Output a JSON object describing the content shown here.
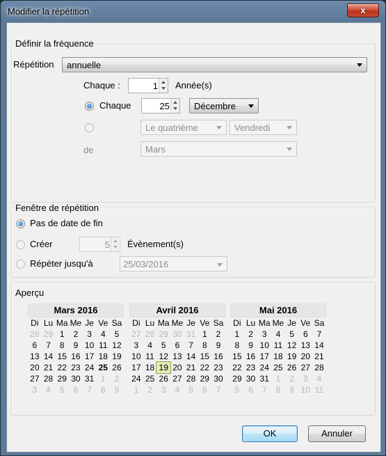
{
  "window": {
    "title": "Modifier la répétition",
    "close_label": "x"
  },
  "frequency": {
    "group_label": "Définir la fréquence",
    "repetition_label": "Répétition",
    "repetition_value": "annuelle",
    "each_label": "Chaque :",
    "each_value": "1",
    "each_unit": "Année(s)",
    "option_each_label": "Chaque",
    "option_each_day": "25",
    "option_each_month": "Décembre",
    "ordinal_value": "Le quatrième",
    "weekday_value": "Vendredi",
    "of_label": "de",
    "of_month_value": "Mars"
  },
  "window_repeat": {
    "group_label": "Fenêtre de répétition",
    "no_end_label": "Pas de date de fin",
    "create_label": "Créer",
    "create_count": "5",
    "create_unit": "Évènement(s)",
    "repeat_until_label": "Répéter jusqu'à",
    "repeat_until_value": "25/03/2016"
  },
  "preview": {
    "group_label": "Aperçu",
    "weekdays": [
      "Di",
      "Lu",
      "Ma",
      "Me",
      "Je",
      "Ve",
      "Sa"
    ],
    "months": [
      {
        "title": "Mars 2016",
        "weeks": [
          [
            [
              "28",
              "o"
            ],
            [
              "29",
              "o"
            ],
            [
              "1",
              ""
            ],
            [
              "2",
              ""
            ],
            [
              "3",
              ""
            ],
            [
              "4",
              ""
            ],
            [
              "5",
              ""
            ]
          ],
          [
            [
              "6",
              ""
            ],
            [
              "7",
              ""
            ],
            [
              "8",
              ""
            ],
            [
              "9",
              ""
            ],
            [
              "10",
              ""
            ],
            [
              "11",
              ""
            ],
            [
              "12",
              ""
            ]
          ],
          [
            [
              "13",
              ""
            ],
            [
              "14",
              ""
            ],
            [
              "15",
              ""
            ],
            [
              "16",
              ""
            ],
            [
              "17",
              ""
            ],
            [
              "18",
              ""
            ],
            [
              "19",
              ""
            ]
          ],
          [
            [
              "20",
              ""
            ],
            [
              "21",
              ""
            ],
            [
              "22",
              ""
            ],
            [
              "23",
              ""
            ],
            [
              "24",
              ""
            ],
            [
              "25",
              "b"
            ],
            [
              "26",
              ""
            ]
          ],
          [
            [
              "27",
              ""
            ],
            [
              "28",
              ""
            ],
            [
              "29",
              ""
            ],
            [
              "30",
              ""
            ],
            [
              "31",
              ""
            ],
            [
              "1",
              "o"
            ],
            [
              "2",
              "o"
            ]
          ],
          [
            [
              "3",
              "o"
            ],
            [
              "4",
              "o"
            ],
            [
              "5",
              "o"
            ],
            [
              "6",
              "o"
            ],
            [
              "7",
              "o"
            ],
            [
              "8",
              "o"
            ],
            [
              "9",
              "o"
            ]
          ]
        ]
      },
      {
        "title": "Avril 2016",
        "weeks": [
          [
            [
              "27",
              "o"
            ],
            [
              "28",
              "o"
            ],
            [
              "29",
              "o"
            ],
            [
              "30",
              "o"
            ],
            [
              "31",
              "o"
            ],
            [
              "1",
              ""
            ],
            [
              "2",
              ""
            ]
          ],
          [
            [
              "3",
              ""
            ],
            [
              "4",
              ""
            ],
            [
              "5",
              ""
            ],
            [
              "6",
              ""
            ],
            [
              "7",
              ""
            ],
            [
              "8",
              ""
            ],
            [
              "9",
              ""
            ]
          ],
          [
            [
              "10",
              ""
            ],
            [
              "11",
              ""
            ],
            [
              "12",
              ""
            ],
            [
              "13",
              ""
            ],
            [
              "14",
              ""
            ],
            [
              "15",
              ""
            ],
            [
              "16",
              ""
            ]
          ],
          [
            [
              "17",
              ""
            ],
            [
              "18",
              ""
            ],
            [
              "19",
              "t"
            ],
            [
              "20",
              ""
            ],
            [
              "21",
              ""
            ],
            [
              "22",
              ""
            ],
            [
              "23",
              ""
            ]
          ],
          [
            [
              "24",
              ""
            ],
            [
              "25",
              ""
            ],
            [
              "26",
              ""
            ],
            [
              "27",
              ""
            ],
            [
              "28",
              ""
            ],
            [
              "29",
              ""
            ],
            [
              "30",
              ""
            ]
          ],
          [
            [
              "1",
              "o"
            ],
            [
              "2",
              "o"
            ],
            [
              "3",
              "o"
            ],
            [
              "4",
              "o"
            ],
            [
              "5",
              "o"
            ],
            [
              "6",
              "o"
            ],
            [
              "7",
              "o"
            ]
          ]
        ]
      },
      {
        "title": "Mai 2016",
        "weeks": [
          [
            [
              "1",
              ""
            ],
            [
              "2",
              ""
            ],
            [
              "3",
              ""
            ],
            [
              "4",
              ""
            ],
            [
              "5",
              ""
            ],
            [
              "6",
              ""
            ],
            [
              "7",
              ""
            ]
          ],
          [
            [
              "8",
              ""
            ],
            [
              "9",
              ""
            ],
            [
              "10",
              ""
            ],
            [
              "11",
              ""
            ],
            [
              "12",
              ""
            ],
            [
              "13",
              ""
            ],
            [
              "14",
              ""
            ]
          ],
          [
            [
              "15",
              ""
            ],
            [
              "16",
              ""
            ],
            [
              "17",
              ""
            ],
            [
              "18",
              ""
            ],
            [
              "19",
              ""
            ],
            [
              "20",
              ""
            ],
            [
              "21",
              ""
            ]
          ],
          [
            [
              "22",
              ""
            ],
            [
              "23",
              ""
            ],
            [
              "24",
              ""
            ],
            [
              "25",
              ""
            ],
            [
              "26",
              ""
            ],
            [
              "27",
              ""
            ],
            [
              "28",
              ""
            ]
          ],
          [
            [
              "29",
              ""
            ],
            [
              "30",
              ""
            ],
            [
              "31",
              ""
            ],
            [
              "1",
              "o"
            ],
            [
              "2",
              "o"
            ],
            [
              "3",
              "o"
            ],
            [
              "4",
              "o"
            ]
          ],
          [
            [
              "5",
              "o"
            ],
            [
              "6",
              "o"
            ],
            [
              "7",
              "o"
            ],
            [
              "8",
              "o"
            ],
            [
              "9",
              "o"
            ],
            [
              "10",
              "o"
            ],
            [
              "11",
              "o"
            ]
          ]
        ]
      }
    ]
  },
  "buttons": {
    "ok": "OK",
    "cancel": "Annuler"
  }
}
